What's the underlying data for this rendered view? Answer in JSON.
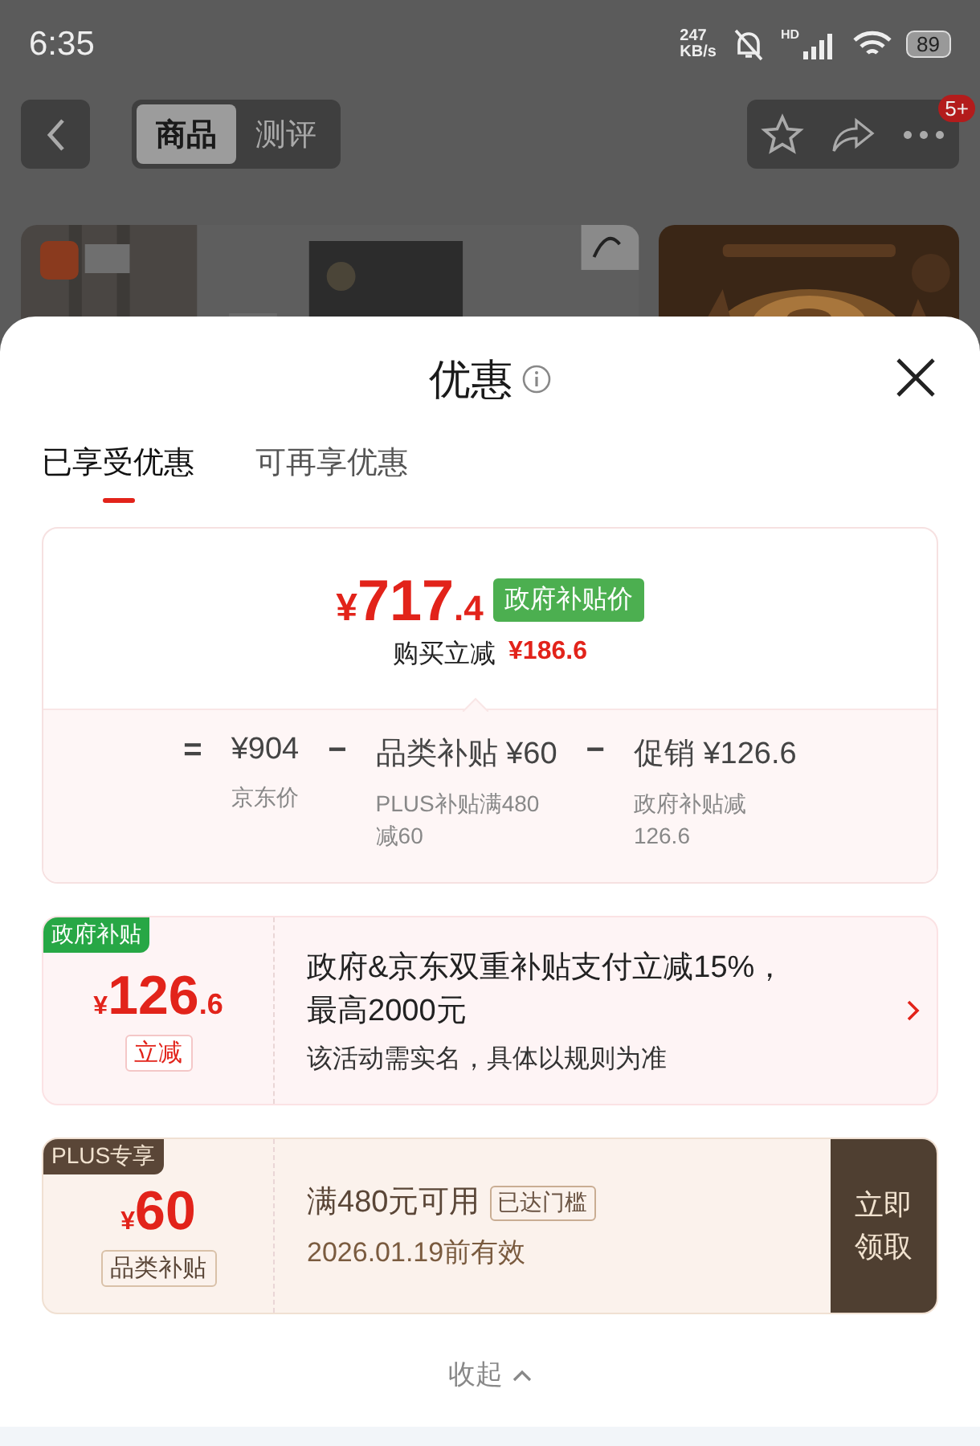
{
  "status_bar": {
    "time": "6:35",
    "speed_value": "247",
    "speed_unit": "KB/s",
    "network_label": "HD",
    "battery": "89"
  },
  "nav": {
    "tabs": [
      {
        "label": "商品",
        "selected": true
      },
      {
        "label": "测评",
        "selected": false
      }
    ],
    "badge": "5+"
  },
  "sheet": {
    "title": "优惠",
    "tabs": [
      {
        "label": "已享受优惠",
        "selected": true
      },
      {
        "label": "可再享优惠",
        "selected": false
      }
    ],
    "summary": {
      "currency": "¥",
      "price_integer": "717",
      "price_decimal": ".4",
      "price_tag": "政府补贴价",
      "reduction_label": "购买立减",
      "reduction_amount": "¥186.6",
      "breakdown": [
        {
          "operator": "=",
          "value": "¥904",
          "note": "京东价"
        },
        {
          "operator": "−",
          "value": "品类补贴 ¥60",
          "note": "PLUS补贴满480减60"
        },
        {
          "operator": "−",
          "value": "促销 ¥126.6",
          "note": "政府补贴减126.6"
        }
      ]
    },
    "coupons": [
      {
        "kind": "government",
        "corner": "政府补贴",
        "currency": "¥",
        "amount_integer": "126",
        "amount_decimal": ".6",
        "tag": "立减",
        "title": "政府&京东双重补贴支付立减15%，最高2000元",
        "subtitle": "该活动需实名，具体以规则为准"
      },
      {
        "kind": "plus",
        "corner": "PLUS专享",
        "currency": "¥",
        "amount_integer": "60",
        "tag": "品类补贴",
        "title": "满480元可用",
        "badge": "已达门槛",
        "subtitle": "2026.01.19前有效",
        "action": "立即领取"
      }
    ],
    "collapse": "收起"
  }
}
